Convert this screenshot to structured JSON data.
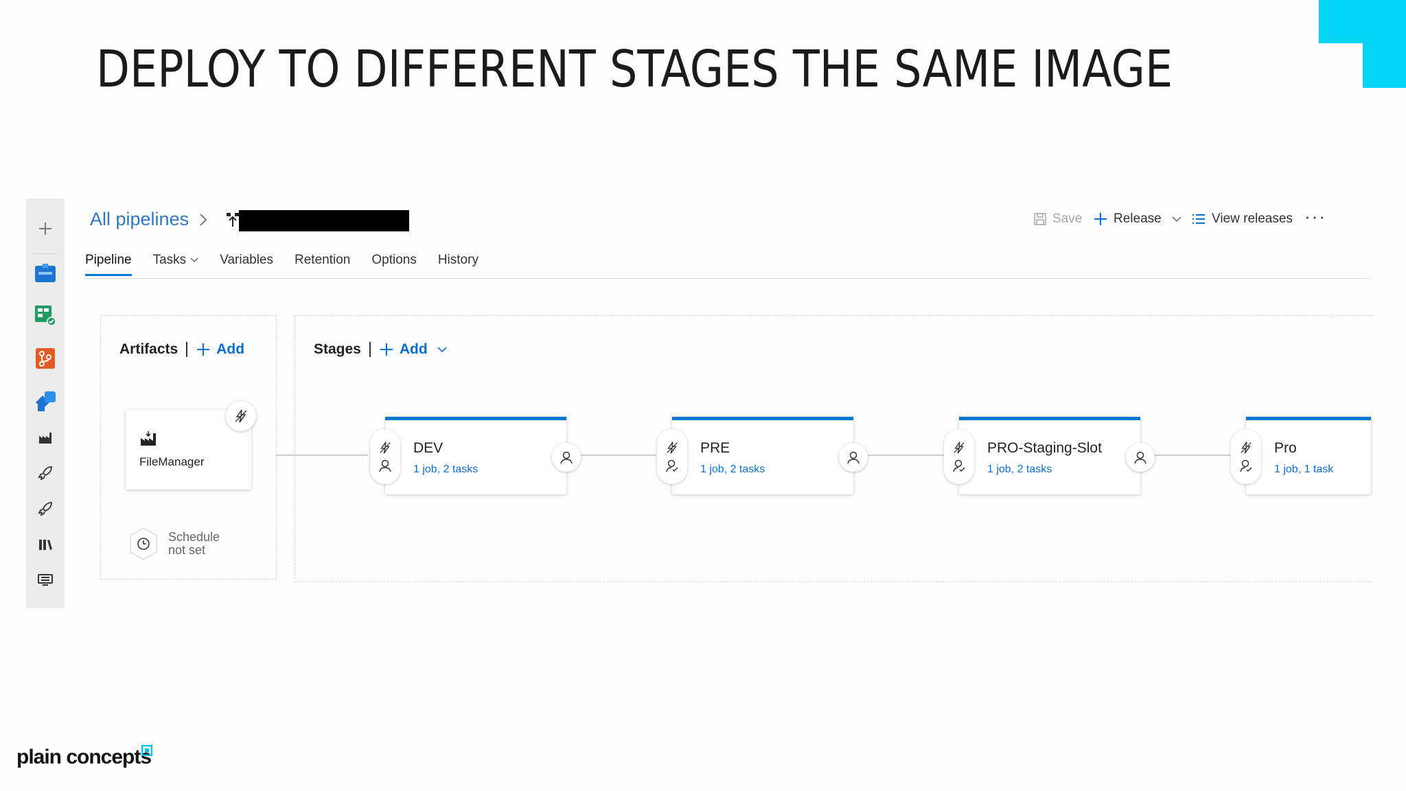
{
  "slide": {
    "title": "DEPLOY TO DIFFERENT STAGES THE SAME IMAGE",
    "brand": "plain concepts",
    "accent_color": "#00d5f5"
  },
  "breadcrumb": {
    "link": "All pipelines"
  },
  "toolbar": {
    "save": "Save",
    "release": "Release",
    "view_releases": "View releases",
    "more": "···"
  },
  "tabs": [
    {
      "label": "Pipeline"
    },
    {
      "label": "Tasks"
    },
    {
      "label": "Variables"
    },
    {
      "label": "Retention"
    },
    {
      "label": "Options"
    },
    {
      "label": "History"
    }
  ],
  "artifacts": {
    "header": "Artifacts",
    "add": "Add",
    "item_name": "FileManager",
    "schedule_line1": "Schedule",
    "schedule_line2": "not set"
  },
  "stages": {
    "header": "Stages",
    "add": "Add",
    "items": [
      {
        "name": "DEV",
        "summary": "1 job, 2 tasks"
      },
      {
        "name": "PRE",
        "summary": "1 job, 2 tasks"
      },
      {
        "name": "PRO-Staging-Slot",
        "summary": "1 job, 2 tasks"
      },
      {
        "name": "Pro",
        "summary": "1 job, 1 task"
      }
    ]
  },
  "colors": {
    "link": "#0a6ed1",
    "tab_indicator": "#0078d4"
  }
}
